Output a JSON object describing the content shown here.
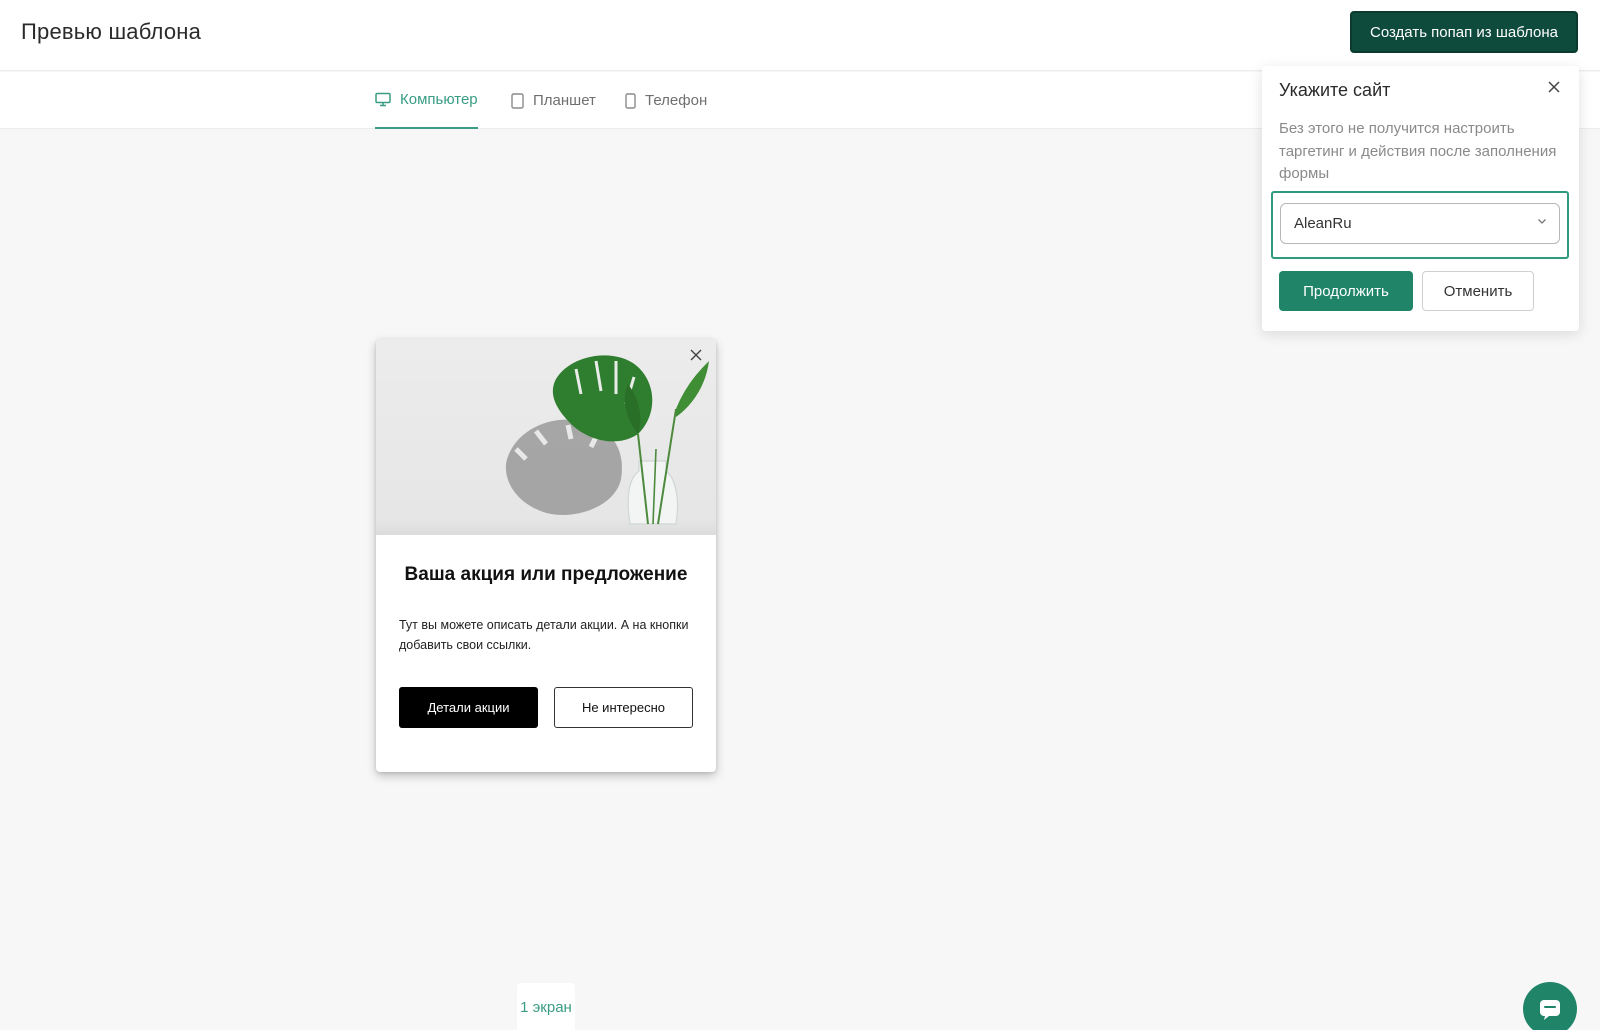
{
  "header": {
    "title": "Превью шаблона",
    "create_button": "Создать попап из шаблона"
  },
  "tabs": [
    {
      "label": "Компьютер",
      "icon": "monitor-icon",
      "active": true
    },
    {
      "label": "Планшет",
      "icon": "tablet-icon",
      "active": false
    },
    {
      "label": "Телефон",
      "icon": "phone-icon",
      "active": false
    }
  ],
  "popup": {
    "title": "Ваша акция или предложение",
    "description": "Тут вы можете описать детали акции. А на кнопки добавить свои ссылки.",
    "primary_button": "Детали акции",
    "secondary_button": "Не интересно"
  },
  "screen_label": "1 экран",
  "site_dialog": {
    "title": "Укажите сайт",
    "description": "Без этого не получится настроить таргетинг и действия после заполнения формы",
    "selected_site": "AleanRu",
    "continue_button": "Продолжить",
    "cancel_button": "Отменить"
  },
  "colors": {
    "accent": "#3a9c84",
    "primary_dark": "#0f4b3c",
    "button_green": "#1f8468",
    "background": "#f7f7f7"
  }
}
